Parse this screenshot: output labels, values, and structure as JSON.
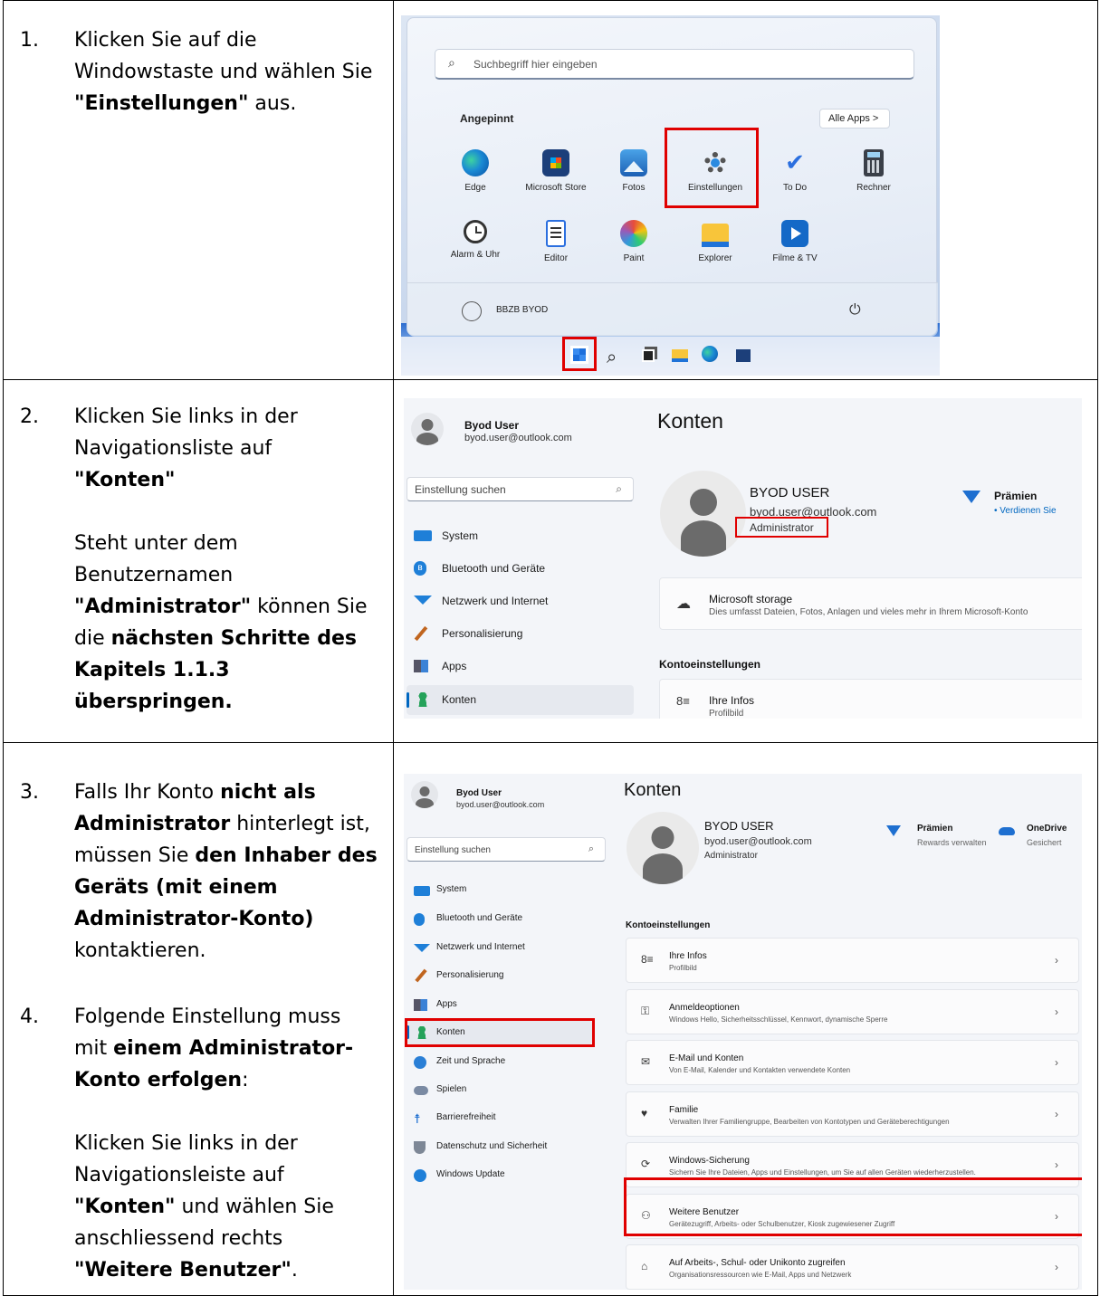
{
  "steps": {
    "s1_num": "1.",
    "s1_a": "Klicken Sie auf die Windowstaste und wählen Sie ",
    "s1_b": "\"Einstellungen\"",
    "s1_c": " aus.",
    "s2_num": "2.",
    "s2_a": "Klicken Sie links in der Navigationsliste auf ",
    "s2_b": "\"Konten\"",
    "s2_c": "Steht unter dem Benutzernamen ",
    "s2_d": "\"Administrator\"",
    "s2_e": " können Sie die ",
    "s2_f": "nächsten Schritte des Kapitels 1.1.3 überspringen.",
    "s3_num": "3.",
    "s3_a": "Falls Ihr Konto ",
    "s3_b": "nicht als Administrator",
    "s3_c": " hinterlegt ist, müssen Sie ",
    "s3_d": "den Inhaber des Geräts (mit einem Administrator-Konto)",
    "s3_e": " kontaktieren.",
    "s4_num": "4.",
    "s4_a": "Folgende Einstellung muss mit ",
    "s4_b": "einem Administrator-Konto erfolgen",
    "s4_c": ":",
    "s4_d": "Klicken Sie links in der Navigationsleiste auf ",
    "s4_e": "\"Konten\"",
    "s4_f": " und wählen Sie anschliessend rechts ",
    "s4_g": "\"Weitere Benutzer\"",
    "s4_h": "."
  },
  "start_menu": {
    "search_placeholder": "Suchbegriff hier eingeben",
    "pinned": "Angepinnt",
    "all_apps": "Alle Apps  >",
    "apps_row1": [
      "Edge",
      "Microsoft Store",
      "Fotos",
      "Einstellungen",
      "To Do",
      "Rechner"
    ],
    "apps_row2": [
      "Alarm & Uhr",
      "Editor",
      "Paint",
      "Explorer",
      "Filme & TV"
    ],
    "user": "BBZB BYOD"
  },
  "settings1": {
    "user_name": "Byod User",
    "user_mail": "byod.user@outlook.com",
    "search": "Einstellung suchen",
    "page_title": "Konten",
    "big_name": "BYOD USER",
    "big_mail": "byod.user@outlook.com",
    "role": "Administrator",
    "rewards_title": "Prämien",
    "rewards_sub": "• Verdienen Sie",
    "nav": [
      "System",
      "Bluetooth und Geräte",
      "Netzwerk und Internet",
      "Personalisierung",
      "Apps",
      "Konten"
    ],
    "storage_title": "Microsoft storage",
    "storage_sub": "Dies umfasst Dateien, Fotos, Anlagen und vieles mehr in Ihrem Microsoft-Konto",
    "section": "Kontoeinstellungen",
    "info_title": "Ihre Infos",
    "info_sub": "Profilbild"
  },
  "settings2": {
    "user_name": "Byod User",
    "user_mail": "byod.user@outlook.com",
    "search": "Einstellung suchen",
    "page_title": "Konten",
    "big_name": "BYOD USER",
    "big_mail": "byod.user@outlook.com",
    "role": "Administrator",
    "rewards_title": "Prämien",
    "rewards_sub": "Rewards verwalten",
    "onedrive_title": "OneDrive",
    "onedrive_sub": "Gesichert",
    "nav": [
      "System",
      "Bluetooth und Geräte",
      "Netzwerk und Internet",
      "Personalisierung",
      "Apps",
      "Konten",
      "Zeit und Sprache",
      "Spielen",
      "Barrierefreiheit",
      "Datenschutz und Sicherheit",
      "Windows Update"
    ],
    "section": "Kontoeinstellungen",
    "cards": [
      {
        "title": "Ihre Infos",
        "sub": "Profilbild"
      },
      {
        "title": "Anmeldeoptionen",
        "sub": "Windows Hello, Sicherheitsschlüssel, Kennwort, dynamische Sperre"
      },
      {
        "title": "E-Mail und Konten",
        "sub": "Von E-Mail, Kalender und Kontakten verwendete Konten"
      },
      {
        "title": "Familie",
        "sub": "Verwalten Ihrer Familiengruppe, Bearbeiten von Kontotypen und Geräteberechtigungen"
      },
      {
        "title": "Windows-Sicherung",
        "sub": "Sichern Sie Ihre Dateien, Apps und Einstellungen, um Sie auf allen Geräten wiederherzustellen."
      },
      {
        "title": "Weitere Benutzer",
        "sub": "Gerätezugriff, Arbeits- oder Schulbenutzer, Kiosk zugewiesener Zugriff"
      },
      {
        "title": "Auf Arbeits-, Schul- oder Unikonto zugreifen",
        "sub": "Organisationsressourcen wie E-Mail, Apps und Netzwerk"
      }
    ]
  },
  "colors": {
    "highlight": "#e00000",
    "accent": "#0067c0"
  }
}
